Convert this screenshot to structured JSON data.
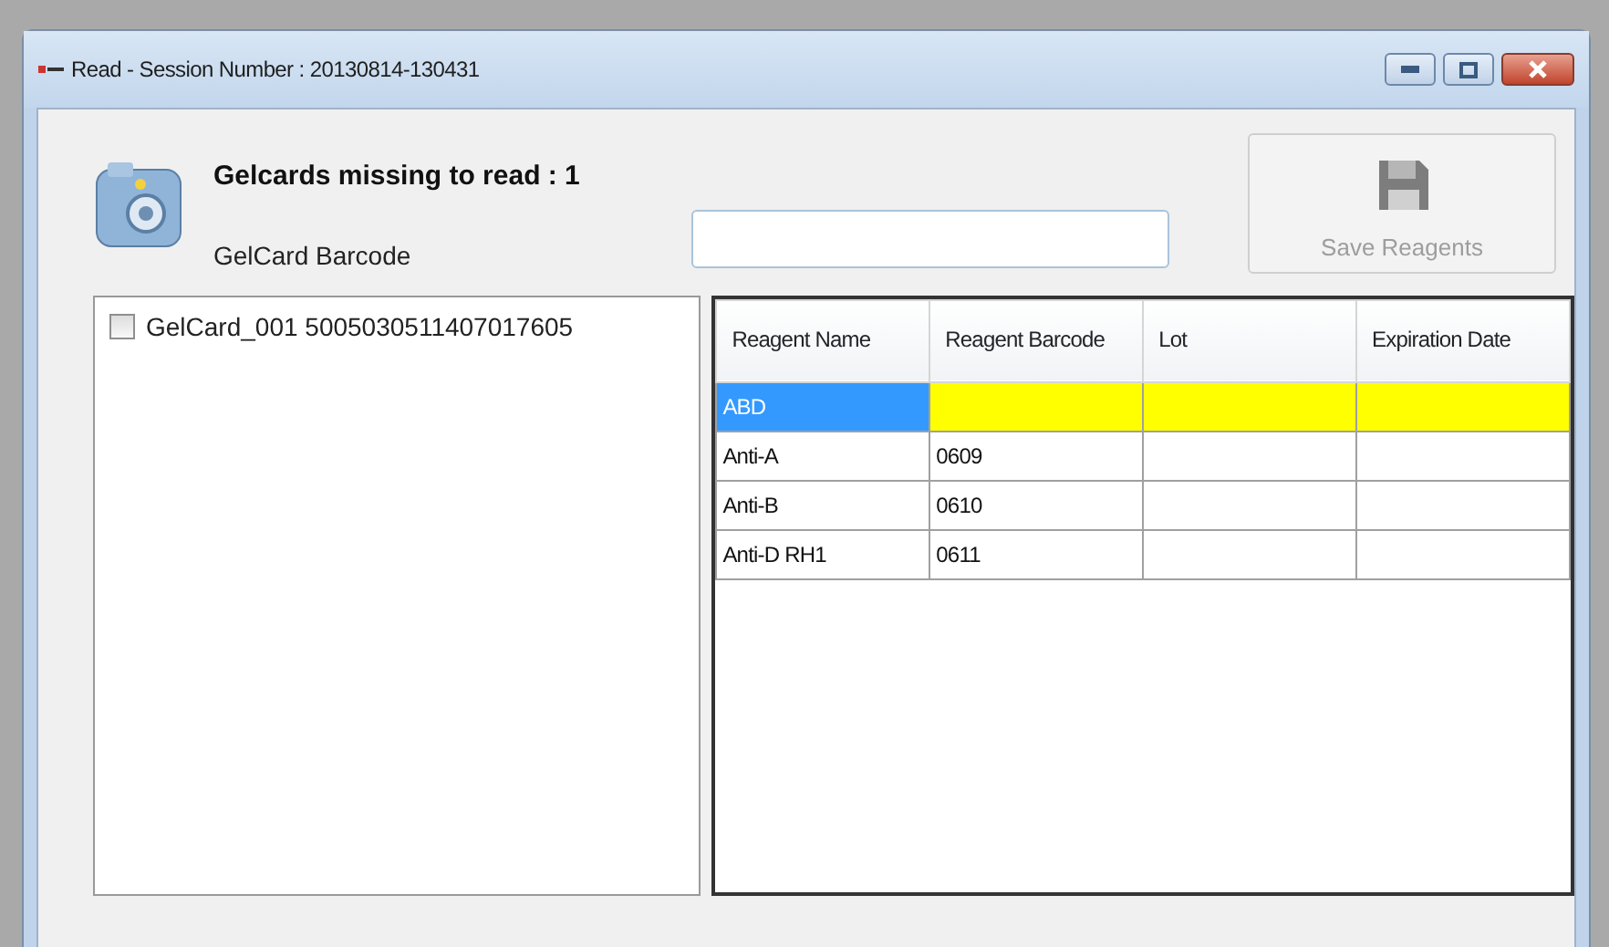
{
  "window": {
    "title": "Read  -  Session Number : 20130814-130431"
  },
  "heading": "Gelcards missing to read : 1",
  "barcode_field": {
    "label": "GelCard Barcode"
  },
  "save_button": {
    "label": "Save Reagents",
    "disabled": true
  },
  "gelcards": [
    {
      "label": "GelCard_001 5005030511407017605",
      "checked": false
    }
  ],
  "table": {
    "columns": [
      "Reagent Name",
      "Reagent Barcode",
      "Lot",
      "Expiration Date"
    ],
    "rows": [
      {
        "cells": [
          "ABD",
          "",
          "",
          ""
        ],
        "selected": true,
        "missing": true
      },
      {
        "cells": [
          "Anti-A",
          "0609",
          "",
          ""
        ],
        "selected": false,
        "missing": false
      },
      {
        "cells": [
          "Anti-B",
          "0610",
          "",
          ""
        ],
        "selected": false,
        "missing": false
      },
      {
        "cells": [
          "Anti-D RH1",
          "0611",
          "",
          ""
        ],
        "selected": false,
        "missing": false
      }
    ]
  }
}
